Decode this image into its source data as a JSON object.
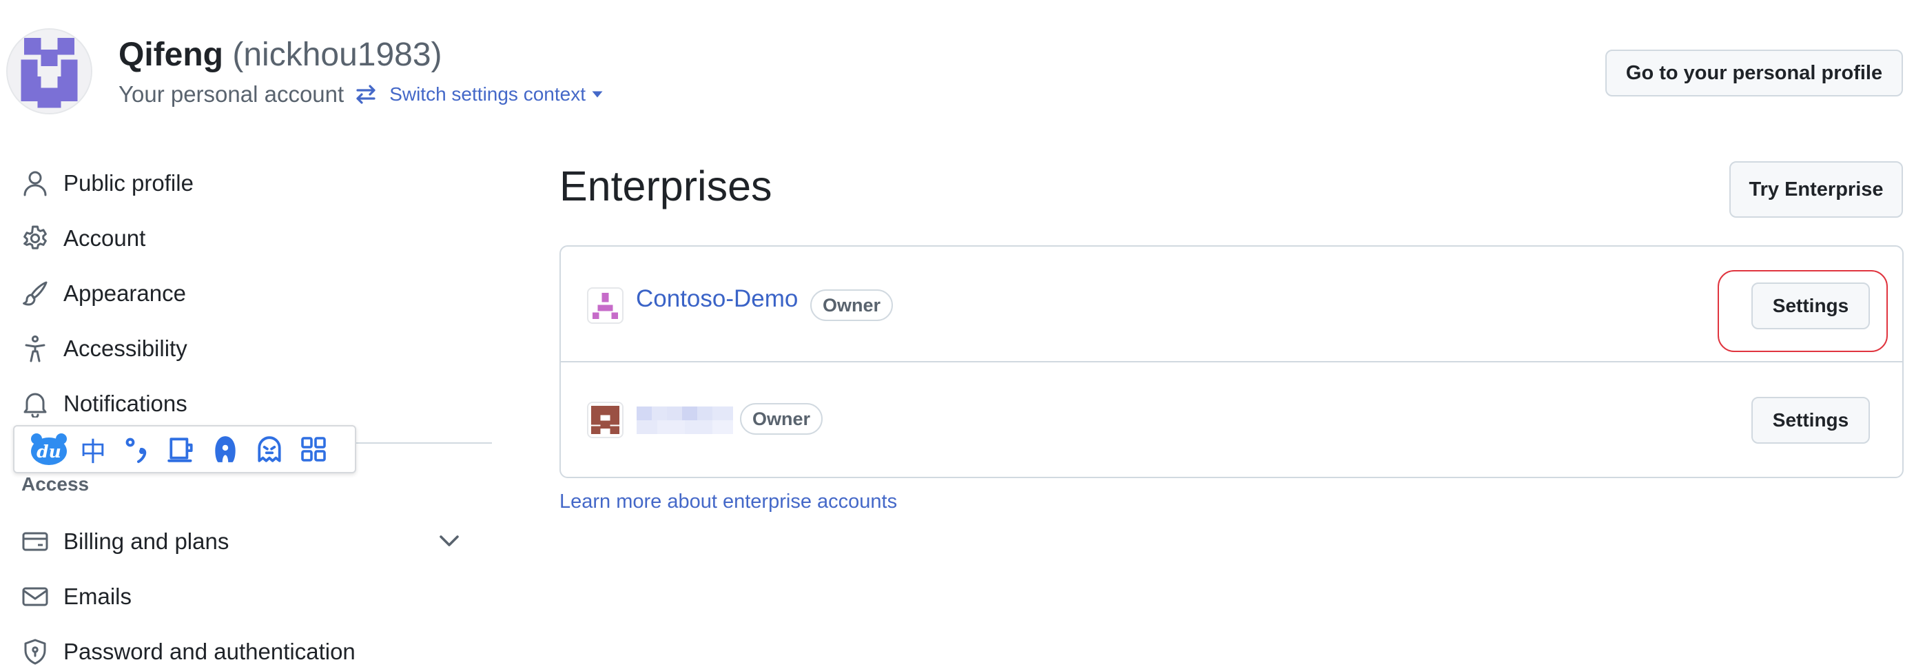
{
  "header": {
    "display_name": "Qifeng",
    "login": "(nickhou1983)",
    "account_label": "Your personal account",
    "switch_context_label": "Switch settings context",
    "profile_button": "Go to your personal profile"
  },
  "sidebar": {
    "items": [
      {
        "label": "Public profile",
        "icon": "person-icon"
      },
      {
        "label": "Account",
        "icon": "gear-icon"
      },
      {
        "label": "Appearance",
        "icon": "paintbrush-icon"
      },
      {
        "label": "Accessibility",
        "icon": "accessibility-icon"
      },
      {
        "label": "Notifications",
        "icon": "bell-icon"
      }
    ],
    "section_heading": "Access",
    "access_items": [
      {
        "label": "Billing and plans",
        "icon": "credit-card-icon",
        "expandable": true
      },
      {
        "label": "Emails",
        "icon": "mail-icon"
      },
      {
        "label": "Password and authentication",
        "icon": "shield-lock-icon"
      }
    ]
  },
  "ime_toolbar": {
    "logo": "du",
    "mode_char": "中",
    "buttons": [
      "baidu-logo-icon",
      "chinese-mode-icon",
      "punctuation-icon",
      "soft-keyboard-icon",
      "skin-icon",
      "emoji-icon",
      "grid-menu-icon"
    ]
  },
  "main": {
    "title": "Enterprises",
    "try_button": "Try Enterprise",
    "enterprises": [
      {
        "name": "Contoso-Demo",
        "role": "Owner",
        "settings_label": "Settings",
        "name_redacted": false
      },
      {
        "name": "",
        "role": "Owner",
        "settings_label": "Settings",
        "name_redacted": true
      }
    ],
    "learn_more": "Learn more about enterprise accounts"
  },
  "colors": {
    "link": "#4468c8",
    "enterprise_name": "#3a63c7",
    "highlight_ring": "#e0353f",
    "avatar_identicon": "#7b70d6",
    "enterprise1_identicon": "#c66bc9",
    "enterprise2_identicon": "#9a5043"
  }
}
